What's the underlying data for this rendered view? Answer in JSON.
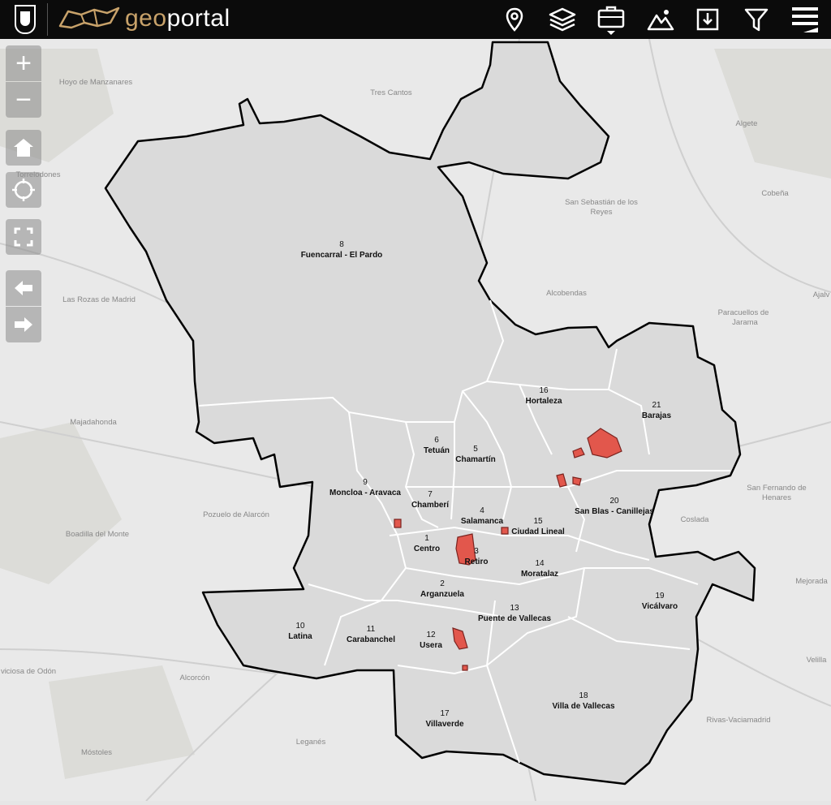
{
  "header": {
    "brand_geo": "geo",
    "brand_portal": "portal",
    "tools": [
      {
        "name": "location-pin-icon"
      },
      {
        "name": "layers-icon"
      },
      {
        "name": "briefcase-icon"
      },
      {
        "name": "terrain-icon"
      },
      {
        "name": "download-icon"
      },
      {
        "name": "filter-icon"
      },
      {
        "name": "menu-icon"
      }
    ]
  },
  "controls": {
    "zoom_in": "+",
    "zoom_out": "−"
  },
  "colors": {
    "topbar": "#0b0b0b",
    "brand_accent": "#c8a26a",
    "district_fill": "#d9d9d9",
    "highlight_fill": "#e2574c"
  },
  "districts": [
    {
      "num": "1",
      "name": "Centro"
    },
    {
      "num": "2",
      "name": "Arganzuela"
    },
    {
      "num": "3",
      "name": "Retiro"
    },
    {
      "num": "4",
      "name": "Salamanca"
    },
    {
      "num": "5",
      "name": "Chamartín"
    },
    {
      "num": "6",
      "name": "Tetuán"
    },
    {
      "num": "7",
      "name": "Chamberí"
    },
    {
      "num": "8",
      "name": "Fuencarral - El Pardo"
    },
    {
      "num": "9",
      "name": "Moncloa - Aravaca"
    },
    {
      "num": "10",
      "name": "Latina"
    },
    {
      "num": "11",
      "name": "Carabanchel"
    },
    {
      "num": "12",
      "name": "Usera"
    },
    {
      "num": "13",
      "name": "Puente de Vallecas"
    },
    {
      "num": "14",
      "name": "Moratalaz"
    },
    {
      "num": "15",
      "name": "Ciudad Lineal"
    },
    {
      "num": "16",
      "name": "Hortaleza"
    },
    {
      "num": "17",
      "name": "Villaverde"
    },
    {
      "num": "18",
      "name": "Villa de Vallecas"
    },
    {
      "num": "19",
      "name": "Vicálvaro"
    },
    {
      "num": "20",
      "name": "San Blas - Canillejas"
    },
    {
      "num": "21",
      "name": "Barajas"
    }
  ],
  "places": [
    "Hoyo de Manzanares",
    "Tres Cantos",
    "Algete",
    "Torrelodones",
    "Cobeña",
    "San Sebastián de los",
    "Reyes",
    "Alcobendas",
    "Las Rozas de Madrid",
    "Paracuellos de",
    "Jarama",
    "Ajalv",
    "Majadahonda",
    "San Fernando de",
    "Henares",
    "Pozuelo de Alarcón",
    "Boadilla del Monte",
    "Coslada",
    "Mejorada",
    "Velilla",
    "Alcorcón",
    "viciosa de Odón",
    "Leganés",
    "Móstoles",
    "Rivas-Vaciamadrid"
  ]
}
